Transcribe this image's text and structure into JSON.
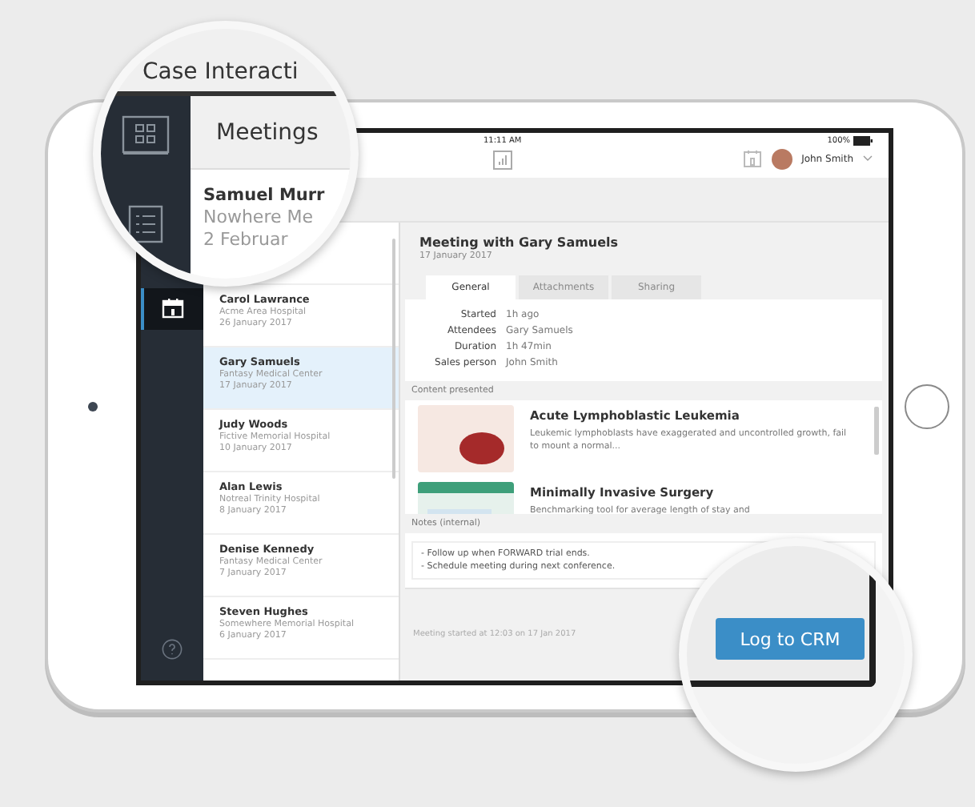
{
  "magnifier_top": {
    "app_title": "Case Interacti",
    "section_title": "Meetings",
    "preview": {
      "name": "Samuel Murr",
      "org": "Nowhere Me",
      "date": "2 Februar"
    }
  },
  "status_bar": {
    "time": "11:11 AM",
    "battery": "100%"
  },
  "user": {
    "name": "John Smith"
  },
  "sidebar": {
    "items": [
      {
        "kind": "calendar",
        "selected": true
      },
      {
        "kind": "help",
        "selected": false
      }
    ]
  },
  "meetings": [
    {
      "name": "Carol Lawrance",
      "org": "Acme Area Hospital",
      "date": "26 January 2017",
      "selected": false
    },
    {
      "name": "Gary Samuels",
      "org": "Fantasy Medical Center",
      "date": "17 January 2017",
      "selected": true
    },
    {
      "name": "Judy Woods",
      "org": "Fictive Memorial Hospital",
      "date": "10 January 2017",
      "selected": false
    },
    {
      "name": "Alan Lewis",
      "org": "Notreal Trinity Hospital",
      "date": "8 January 2017",
      "selected": false
    },
    {
      "name": "Denise Kennedy",
      "org": "Fantasy Medical Center",
      "date": "7 January 2017",
      "selected": false
    },
    {
      "name": "Steven Hughes",
      "org": "Somewhere Memorial Hospital",
      "date": "6 January 2017",
      "selected": false
    }
  ],
  "detail": {
    "title": "Meeting with Gary Samuels",
    "date": "17 January 2017",
    "tabs": [
      {
        "label": "General",
        "selected": true
      },
      {
        "label": "Attachments",
        "selected": false
      },
      {
        "label": "Sharing",
        "selected": false
      }
    ],
    "fields": [
      {
        "label": "Started",
        "value": "1h ago"
      },
      {
        "label": "Attendees",
        "value": "Gary Samuels"
      },
      {
        "label": "Duration",
        "value": "1h 47min"
      },
      {
        "label": "Sales person",
        "value": "John Smith"
      }
    ],
    "content_label": "Content presented",
    "content": [
      {
        "kind": "slide",
        "title": "Acute Lymphoblastic Leukemia",
        "description": "Leukemic lymphoblasts have exaggerated and uncontrolled growth, fail to mount a normal..."
      },
      {
        "kind": "dashboard",
        "title": "Minimally Invasive Surgery",
        "description": "Benchmarking tool for average length of stay and"
      }
    ],
    "notes_label": "Notes (internal)",
    "notes": [
      "- Follow up when FORWARD trial ends.",
      "- Schedule meeting during next conference."
    ],
    "footer": "Meeting started at 12:03 on 17 Jan 2017"
  },
  "crm_button": "Log to CRM"
}
